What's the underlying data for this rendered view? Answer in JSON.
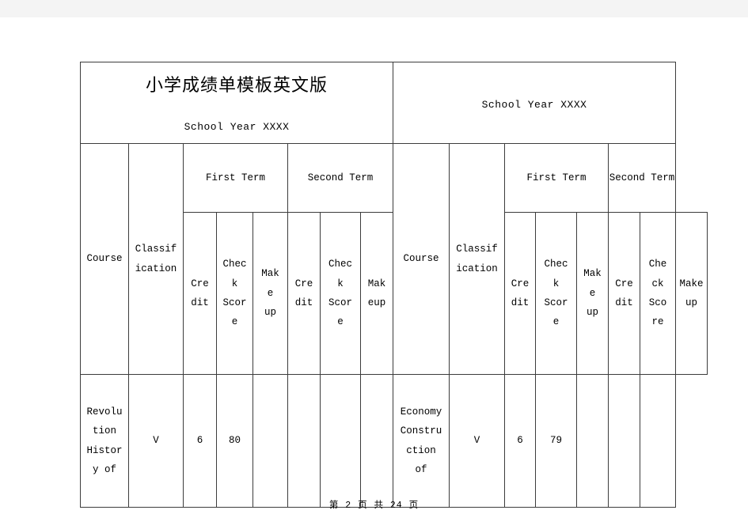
{
  "document": {
    "title_cn": "小学成绩单模板英文版",
    "school_year_left": "School Year XXXX",
    "school_year_right": "School Year XXXX",
    "footer": "第 2 页 共 24 页"
  },
  "left_table": {
    "headers": {
      "course": "Course",
      "classification": "Classif\nication",
      "first_term": "First Term",
      "second_term": "Second Term",
      "first_credit": "Cre\ndit",
      "first_check_score": "Chec\nk\nScor\ne",
      "first_makeup": "Mak\ne\nup",
      "second_credit": "Cre\ndit",
      "second_check_score": "Chec\nk\nScor\ne",
      "second_makeup": "Mak\neup"
    },
    "rows": [
      {
        "course": "Revolu\ntion\nHistor\ny of",
        "classification": "V",
        "first_credit": "6",
        "first_check_score": "80",
        "first_makeup": "",
        "second_credit": "",
        "second_check_score": "",
        "second_makeup": ""
      }
    ]
  },
  "right_table": {
    "headers": {
      "course": "Course",
      "classification": "Classif\nication",
      "first_term": "First Term",
      "second_term": "Second Term",
      "first_credit": "Cre\ndit",
      "first_check_score": "Chec\nk\nScor\ne",
      "first_makeup": "Mak\ne\nup",
      "second_credit": "Cre\ndit",
      "second_check_score": "Che\nck\nSco\nre",
      "second_makeup": "Make\nup"
    },
    "rows": [
      {
        "course": "Economy\nConstru\nction\nof",
        "classification": "V",
        "first_credit": "6",
        "first_check_score": "79",
        "first_makeup": "",
        "second_credit": "",
        "second_check_score": "",
        "second_makeup": ""
      }
    ]
  }
}
